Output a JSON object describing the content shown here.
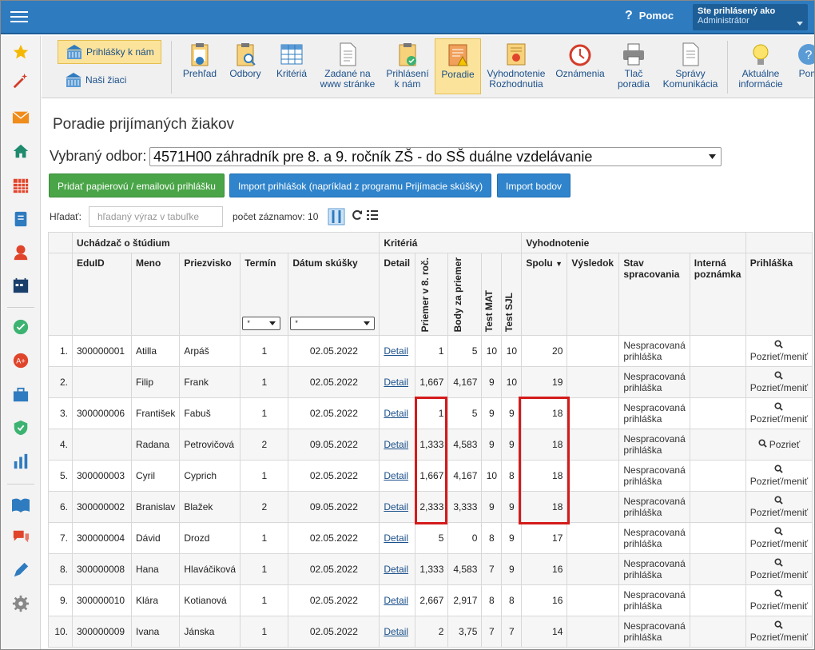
{
  "header": {
    "help_label": "Pomoc",
    "user_line1": "Ste prihlásený ako",
    "user_line2": "Administrátor"
  },
  "toolbar": {
    "side_buttons": [
      "Prihlášky k nám",
      "Naši žiaci"
    ],
    "buttons": [
      {
        "label": "Prehľad",
        "icon": "clipboard-eye-icon"
      },
      {
        "label": "Odbory",
        "icon": "clipboard-search-icon"
      },
      {
        "label": "Kritériá",
        "icon": "table-grid-icon"
      },
      {
        "label": "Zadané na www stránke",
        "icon": "web-document-icon"
      },
      {
        "label": "Prihlásení k nám",
        "icon": "clipboard-check-icon"
      },
      {
        "label": "Poradie",
        "icon": "clipboard-warning-icon"
      },
      {
        "label": "Vyhodnotenie Rozhodnutia",
        "icon": "certificate-icon"
      },
      {
        "label": "Oznámenia",
        "icon": "clock-icon"
      },
      {
        "label": "Tlač poradia",
        "icon": "printer-icon"
      },
      {
        "label": "Správy Komunikácia",
        "icon": "document-icon"
      },
      {
        "label": "Aktuálne informácie",
        "icon": "lightbulb-icon"
      },
      {
        "label": "Pom",
        "icon": "help-icon"
      }
    ]
  },
  "page": {
    "title": "Poradie prijímaných žiakov",
    "odbor_label": "Vybraný odbor:",
    "odbor_value": "4571H00 záhradník pre 8. a 9. ročník ZŠ - do SŠ duálne vzdelávanie",
    "btn_add": "Pridať papierovú / emailovú prihlášku",
    "btn_import": "Import prihlášok (napríklad z programu Prijímacie skúšky)",
    "btn_import_points": "Import bodov",
    "search_label": "Hľadať:",
    "search_placeholder": "hľadaný výraz v tabuľke",
    "count_label": "počet záznamov: 10"
  },
  "table": {
    "group_headers": [
      "Uchádzač o štúdium",
      "Kritériá",
      "Vyhodnotenie"
    ],
    "headers": {
      "eduid": "EduID",
      "meno": "Meno",
      "priezvisko": "Priezvisko",
      "termin": "Termín",
      "datum": "Dátum skúšky",
      "detail": "Detail",
      "priemer": "Priemer v 8. roč.",
      "body": "Body za priemer",
      "mat": "Test MAT",
      "sjl": "Test SJL",
      "spolu": "Spolu",
      "vysledok": "Výsledok",
      "stav": "Stav spracovania",
      "poznamka": "Interná poznámka",
      "prihlaska": "Prihláška"
    },
    "filter_value": "*",
    "rows": [
      {
        "n": "1.",
        "eduid": "300000001",
        "meno": "Atilla",
        "priezvisko": "Arpáš",
        "termin": "1",
        "datum": "02.05.2022",
        "detail": "Detail",
        "priemer": "1",
        "body": "5",
        "mat": "10",
        "sjl": "10",
        "spolu": "20",
        "stav": "Nespracovaná prihláška",
        "action": "Pozrieť/meniť"
      },
      {
        "n": "2.",
        "eduid": "",
        "meno": "Filip",
        "priezvisko": "Frank",
        "termin": "1",
        "datum": "02.05.2022",
        "detail": "Detail",
        "priemer": "1,667",
        "body": "4,167",
        "mat": "9",
        "sjl": "10",
        "spolu": "19",
        "stav": "Nespracovaná prihláška",
        "action": "Pozrieť/meniť"
      },
      {
        "n": "3.",
        "eduid": "300000006",
        "meno": "František",
        "priezvisko": "Fabuš",
        "termin": "1",
        "datum": "02.05.2022",
        "detail": "Detail",
        "priemer": "1",
        "body": "5",
        "mat": "9",
        "sjl": "9",
        "spolu": "18",
        "stav": "Nespracovaná prihláška",
        "action": "Pozrieť/meniť"
      },
      {
        "n": "4.",
        "eduid": "",
        "meno": "Radana",
        "priezvisko": "Petrovičová",
        "termin": "2",
        "datum": "09.05.2022",
        "detail": "Detail",
        "priemer": "1,333",
        "body": "4,583",
        "mat": "9",
        "sjl": "9",
        "spolu": "18",
        "stav": "Nespracovaná prihláška",
        "action": "Pozrieť"
      },
      {
        "n": "5.",
        "eduid": "300000003",
        "meno": "Cyril",
        "priezvisko": "Cyprich",
        "termin": "1",
        "datum": "02.05.2022",
        "detail": "Detail",
        "priemer": "1,667",
        "body": "4,167",
        "mat": "10",
        "sjl": "8",
        "spolu": "18",
        "stav": "Nespracovaná prihláška",
        "action": "Pozrieť/meniť"
      },
      {
        "n": "6.",
        "eduid": "300000002",
        "meno": "Branislav",
        "priezvisko": "Blažek",
        "termin": "2",
        "datum": "09.05.2022",
        "detail": "Detail",
        "priemer": "2,333",
        "body": "3,333",
        "mat": "9",
        "sjl": "9",
        "spolu": "18",
        "stav": "Nespracovaná prihláška",
        "action": "Pozrieť/meniť"
      },
      {
        "n": "7.",
        "eduid": "300000004",
        "meno": "Dávid",
        "priezvisko": "Drozd",
        "termin": "1",
        "datum": "02.05.2022",
        "detail": "Detail",
        "priemer": "5",
        "body": "0",
        "mat": "8",
        "sjl": "9",
        "spolu": "17",
        "stav": "Nespracovaná prihláška",
        "action": "Pozrieť/meniť"
      },
      {
        "n": "8.",
        "eduid": "300000008",
        "meno": "Hana",
        "priezvisko": "Hlaváčiková",
        "termin": "1",
        "datum": "02.05.2022",
        "detail": "Detail",
        "priemer": "1,333",
        "body": "4,583",
        "mat": "7",
        "sjl": "9",
        "spolu": "16",
        "stav": "Nespracovaná prihláška",
        "action": "Pozrieť/meniť"
      },
      {
        "n": "9.",
        "eduid": "300000010",
        "meno": "Klára",
        "priezvisko": "Kotianová",
        "termin": "1",
        "datum": "02.05.2022",
        "detail": "Detail",
        "priemer": "2,667",
        "body": "2,917",
        "mat": "8",
        "sjl": "8",
        "spolu": "16",
        "stav": "Nespracovaná prihláška",
        "action": "Pozrieť/meniť"
      },
      {
        "n": "10.",
        "eduid": "300000009",
        "meno": "Ivana",
        "priezvisko": "Jánska",
        "termin": "1",
        "datum": "02.05.2022",
        "detail": "Detail",
        "priemer": "2",
        "body": "3,75",
        "mat": "7",
        "sjl": "7",
        "spolu": "14",
        "stav": "Nespracovaná prihláška",
        "action": "Pozrieť/meniť"
      }
    ]
  },
  "colors": {
    "topbar": "#2f7bbf",
    "active": "#fbe39b",
    "green": "#4aa548",
    "blue": "#2f84cc",
    "highlight": "#d41a1a"
  }
}
